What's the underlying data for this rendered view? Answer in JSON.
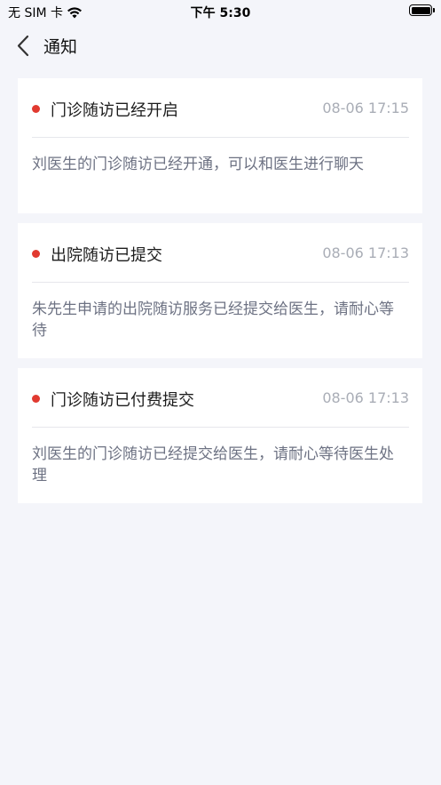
{
  "status_bar": {
    "carrier": "无 SIM 卡",
    "time": "下午 5:30"
  },
  "nav": {
    "title": "通知"
  },
  "notifications": [
    {
      "title": "门诊随访已经开启",
      "time": "08-06 17:15",
      "body": "刘医生的门诊随访已经开通，可以和医生进行聊天"
    },
    {
      "title": "出院随访已提交",
      "time": "08-06 17:13",
      "body": "朱先生申请的出院随访服务已经提交给医生，请耐心等待"
    },
    {
      "title": "门诊随访已付费提交",
      "time": "08-06 17:13",
      "body": "刘医生的门诊随访已经提交给医生，请耐心等待医生处理"
    }
  ],
  "colors": {
    "unread_dot": "#e13a30",
    "background": "#f4f5fa",
    "time_text": "#a9adb6",
    "body_text": "#6d7283"
  }
}
